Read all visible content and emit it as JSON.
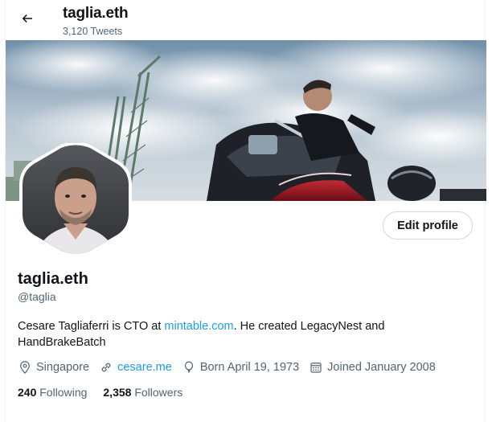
{
  "header": {
    "title": "taglia.eth",
    "tweet_count": "3,120 Tweets"
  },
  "profile": {
    "edit_button": "Edit profile",
    "name": "taglia.eth",
    "handle": "@taglia",
    "bio": {
      "before": "Cesare Tagliaferri is CTO at ",
      "link": "mintable.com",
      "after": ". He created LegacyNest and HandBrakeBatch"
    },
    "meta": {
      "location": "Singapore",
      "website": "cesare.me",
      "birthday": "Born April 19, 1973",
      "joined": "Joined January 2008"
    },
    "stats": {
      "following_count": "240",
      "following_label": "Following",
      "followers_count": "2,358",
      "followers_label": "Followers"
    }
  },
  "icons": {
    "back": "arrow-left-icon",
    "location": "location-pin-icon",
    "website": "link-icon",
    "birthday": "balloon-icon",
    "joined": "calendar-icon"
  },
  "colors": {
    "accent": "#1d9bf0",
    "secondary_text": "#536471",
    "primary_text": "#0f1419"
  }
}
